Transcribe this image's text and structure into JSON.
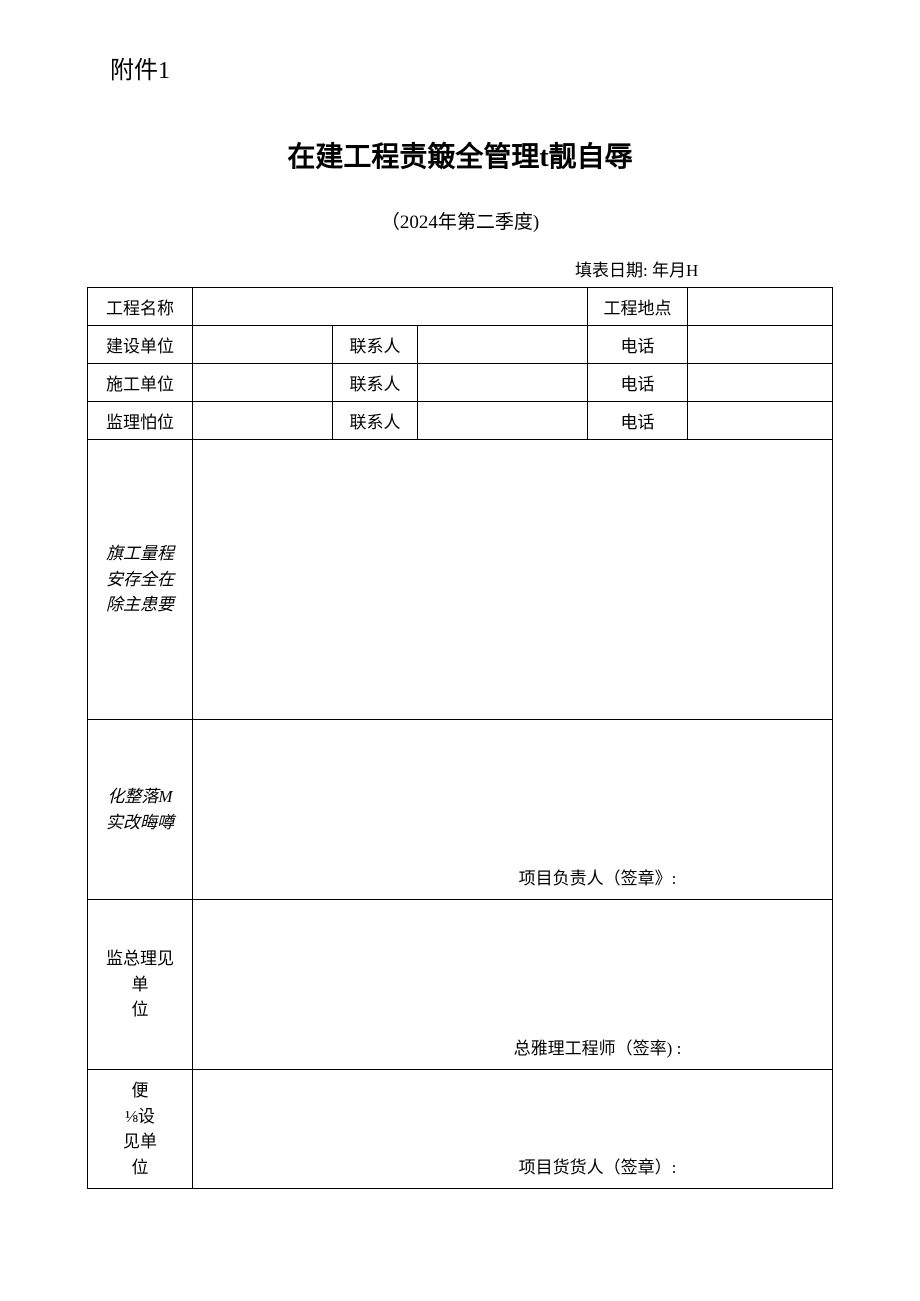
{
  "header": {
    "attachment": "附件1",
    "title": "在建工程责簸全管理t靓自辱",
    "subtitle": "（2024年第二季度)",
    "date_label": "填表日期:  年月H"
  },
  "labels": {
    "project_name": "工程名称",
    "project_location": "工程地点",
    "construction_unit": "建设单位",
    "contact": "联系人",
    "phone": "电话",
    "contractor_unit": "施工单位",
    "supervision_unit": "监理怕位",
    "hidden_danger": "旗工量程安存全在除主患要",
    "rectification": "化整落M实改晦噂",
    "supervision_opinion": "监总理见\n单\n位",
    "construction_opinion": "便\n⅛设\n见单\n位"
  },
  "signatures": {
    "project_leader": "项目负责人（签章》:",
    "chief_engineer": "总雅理工程师（签率) :",
    "project_goods": "项目货货人（签章）:"
  },
  "values": {
    "project_name": "",
    "project_location": "",
    "construction_unit": "",
    "construction_contact": "",
    "construction_phone": "",
    "contractor_unit": "",
    "contractor_contact": "",
    "contractor_phone": "",
    "supervision_unit_v": "",
    "supervision_contact": "",
    "supervision_phone": "",
    "hidden_danger_content": "",
    "rectification_content": ""
  }
}
